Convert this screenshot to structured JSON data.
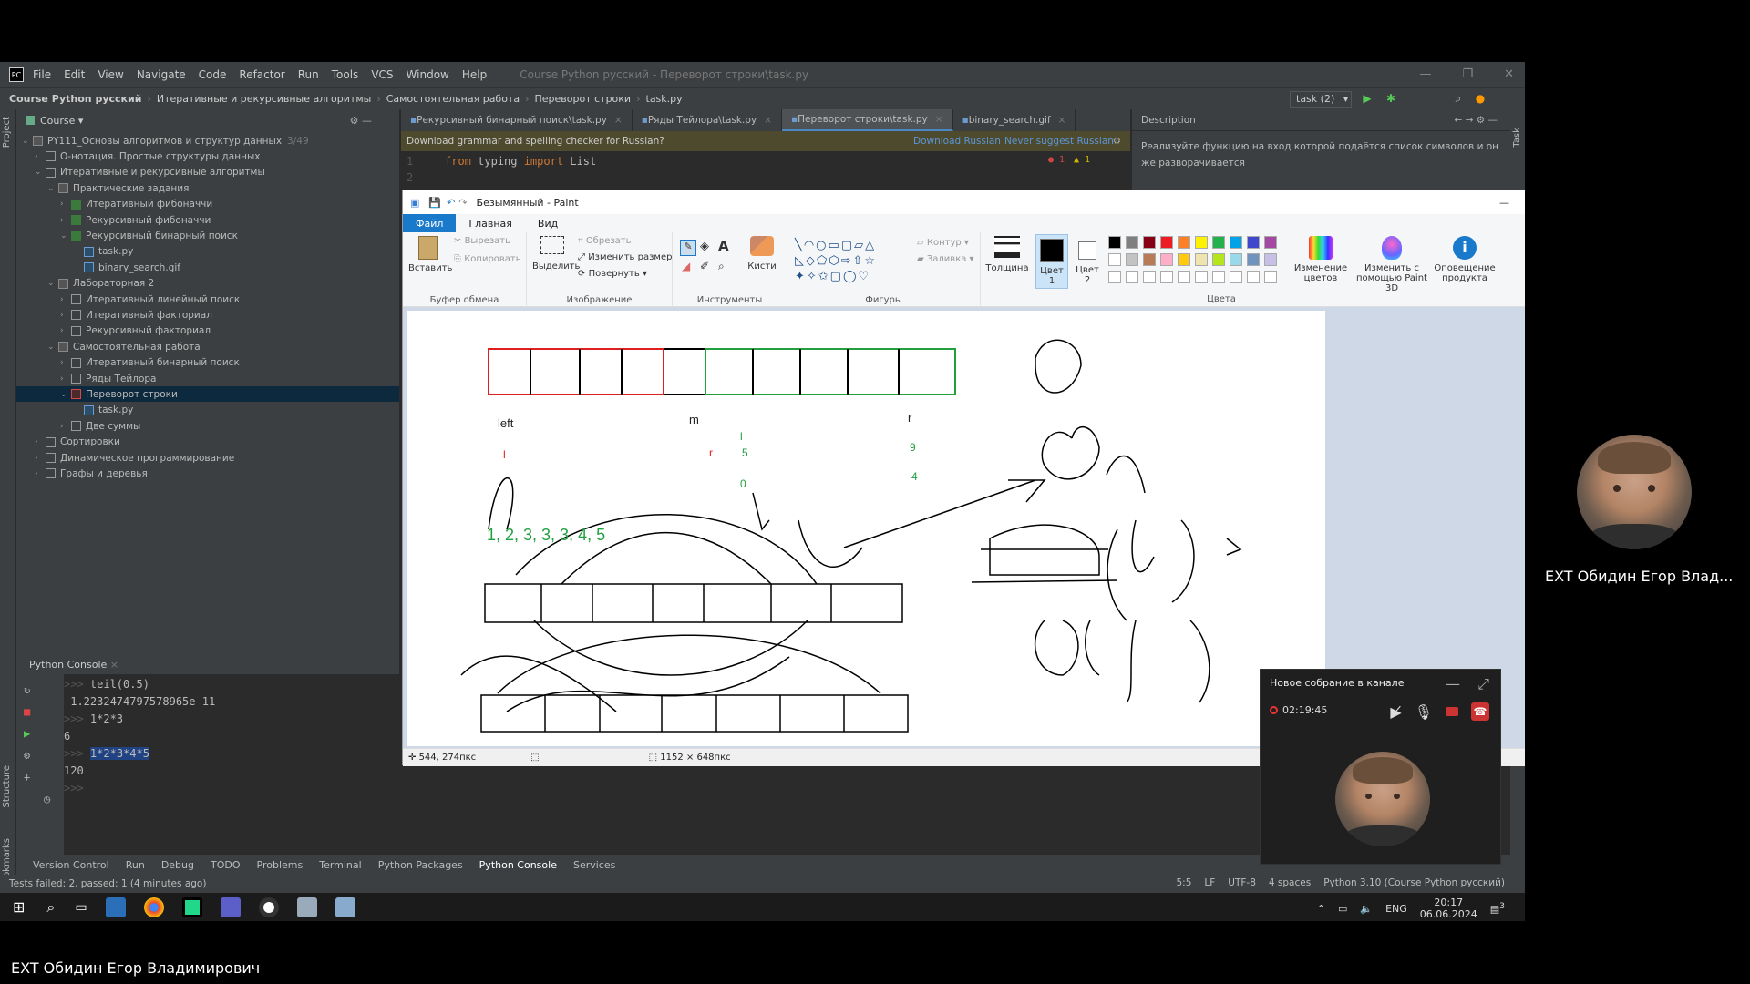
{
  "ide": {
    "menu": [
      "File",
      "Edit",
      "View",
      "Navigate",
      "Code",
      "Refactor",
      "Run",
      "Tools",
      "VCS",
      "Window",
      "Help"
    ],
    "window_title": "Course Python русский - Переворот строки\\task.py",
    "breadcrumb": [
      "Course Python русский",
      "Итеративные и рекурсивные алгоритмы",
      "Самостоятельная работа",
      "Переворот строки",
      "task.py"
    ],
    "run_config": "task (2)",
    "project_panel": {
      "title": "Course"
    },
    "left_strip_labels": [
      "Project",
      "Structure",
      "Bookmarks"
    ],
    "tree": [
      {
        "label": "PY111_Основы алгоритмов и структур данных",
        "suffix": "3/49",
        "depth": 0,
        "arrow": "v",
        "icon": "grid"
      },
      {
        "label": "О-нотация. Простые структуры данных",
        "depth": 1,
        "arrow": ">",
        "icon": "box"
      },
      {
        "label": "Итеративные и рекурсивные алгоритмы",
        "depth": 1,
        "arrow": "v",
        "icon": "box"
      },
      {
        "label": "Практические задания",
        "depth": 2,
        "arrow": "v",
        "icon": "grid"
      },
      {
        "label": "Итеративный фибоначчи",
        "depth": 3,
        "arrow": ">",
        "icon": "green"
      },
      {
        "label": "Рекурсивный фибоначчи",
        "depth": 3,
        "arrow": ">",
        "icon": "green"
      },
      {
        "label": "Рекурсивный бинарный поиск",
        "depth": 3,
        "arrow": "v",
        "icon": "green"
      },
      {
        "label": "task.py",
        "depth": 4,
        "arrow": "",
        "icon": "file"
      },
      {
        "label": "binary_search.gif",
        "depth": 4,
        "arrow": "",
        "icon": "file"
      },
      {
        "label": "Лабораторная 2",
        "depth": 2,
        "arrow": "v",
        "icon": "grid"
      },
      {
        "label": "Итеративный линейный поиск",
        "depth": 3,
        "arrow": ">",
        "icon": "box"
      },
      {
        "label": "Итеративный факториал",
        "depth": 3,
        "arrow": ">",
        "icon": "box"
      },
      {
        "label": "Рекурсивный факториал",
        "depth": 3,
        "arrow": ">",
        "icon": "box"
      },
      {
        "label": "Самостоятельная работа",
        "depth": 2,
        "arrow": "v",
        "icon": "grid"
      },
      {
        "label": "Итеративный бинарный поиск",
        "depth": 3,
        "arrow": ">",
        "icon": "box"
      },
      {
        "label": "Ряды Тейлора",
        "depth": 3,
        "arrow": ">",
        "icon": "box"
      },
      {
        "label": "Переворот строки",
        "depth": 3,
        "arrow": "v",
        "icon": "red",
        "selected": true
      },
      {
        "label": "task.py",
        "depth": 4,
        "arrow": "",
        "icon": "file"
      },
      {
        "label": "Две суммы",
        "depth": 3,
        "arrow": ">",
        "icon": "box"
      },
      {
        "label": "Сортировки",
        "depth": 1,
        "arrow": ">",
        "icon": "box"
      },
      {
        "label": "Динамическое программирование",
        "depth": 1,
        "arrow": ">",
        "icon": "box"
      },
      {
        "label": "Графы и деревья",
        "depth": 1,
        "arrow": ">",
        "icon": "box"
      }
    ],
    "editor_tabs": [
      {
        "label": "Рекурсивный бинарный поиск\\task.py",
        "active": false
      },
      {
        "label": "Ряды Тейлора\\task.py",
        "active": false
      },
      {
        "label": "Переворот строки\\task.py",
        "active": true
      },
      {
        "label": "binary_search.gif",
        "active": false
      }
    ],
    "grammar_banner": {
      "text": "Download grammar and spelling checker for Russian?",
      "download": "Download Russian",
      "never": "Never suggest Russian"
    },
    "code_lines": [
      {
        "num": "1",
        "kw1": "from",
        "mod": " typing ",
        "kw2": "import",
        "name": " List"
      },
      {
        "num": "2"
      }
    ],
    "inspection": {
      "errors": "1",
      "warnings": "1"
    },
    "description": {
      "title": "Description",
      "text": "Реализуйте функцию на вход которой подаётся список символов и он же разворачивается"
    },
    "right_strip_label": "Task",
    "console": {
      "title": "Python Console",
      "lines": [
        {
          "prompt": ">>>",
          "text": " teil(0.5)"
        },
        {
          "prompt": "",
          "text": "-1.2232474797578965e-11"
        },
        {
          "prompt": ">>>",
          "text": " 1*2*3"
        },
        {
          "prompt": "",
          "text": "6"
        },
        {
          "prompt": ">>>",
          "text": " ",
          "hl": "1*2*3*4*5"
        },
        {
          "prompt": "",
          "text": "120"
        },
        {
          "prompt": ">>>",
          "text": ""
        }
      ]
    },
    "bottom_tabs": [
      "Version Control",
      "Run",
      "Debug",
      "TODO",
      "Problems",
      "Terminal",
      "Python Packages",
      "Python Console",
      "Services"
    ],
    "bottom_tab_active": "Python Console",
    "status_left": "Tests failed: 2, passed: 1 (4 minutes ago)",
    "status_right": [
      "5:5",
      "LF",
      "UTF-8",
      "4 spaces",
      "Python 3.10 (Course Python русский)"
    ]
  },
  "paint": {
    "title": "Безымянный - Paint",
    "tabs": [
      "Файл",
      "Главная",
      "Вид"
    ],
    "clipboard": {
      "paste": "Вставить",
      "cut": "Вырезать",
      "copy": "Копировать",
      "group": "Буфер обмена"
    },
    "image": {
      "select": "Выделить",
      "crop": "Обрезать",
      "resize": "Изменить размер",
      "rotate": "Повернуть",
      "group": "Изображение"
    },
    "tools": {
      "brushes": "Кисти",
      "group": "Инструменты"
    },
    "shapes": {
      "outline": "Контур",
      "fill": "Заливка",
      "group": "Фигуры"
    },
    "size": "Толщина",
    "color1": "Цвет 1",
    "color2": "Цвет 2",
    "colors_group": "Цвета",
    "edit_colors": "Изменение цветов",
    "paint3d": "Изменить с помощью Paint 3D",
    "notify": "Оповещение продукта",
    "palette": [
      "#000000",
      "#7f7f7f",
      "#880015",
      "#ed1c24",
      "#ff7f27",
      "#fff200",
      "#22b14c",
      "#00a2e8",
      "#3f48cc",
      "#a349a4",
      "#ffffff",
      "#c3c3c3",
      "#b97a57",
      "#ffaec9",
      "#ffc90e",
      "#efe4b0",
      "#b5e61d",
      "#99d9ea",
      "#7092be",
      "#c8bfe7"
    ],
    "canvas_labels": {
      "left": "left",
      "m": "m",
      "r": "r",
      "l_red": "l",
      "r_red": "r",
      "l_green": "l",
      "n5": "5",
      "n0": "0",
      "n9": "9",
      "n4": "4",
      "sequence": "1, 2, 3, 3, 3, 4, 5"
    },
    "status": {
      "cursor": "544, 274пкс",
      "size": "1152 × 648пкс"
    }
  },
  "meeting": {
    "title": "Новое собрание в канале",
    "timer": "02:19:45"
  },
  "participant_name_right": "EXT Обидин Егор Влад...",
  "participant_name_bottom": "EXT Обидин Егор Владимирович",
  "taskbar": {
    "lang": "ENG",
    "time": "20:17",
    "date": "06.06.2024",
    "notif": "3"
  }
}
